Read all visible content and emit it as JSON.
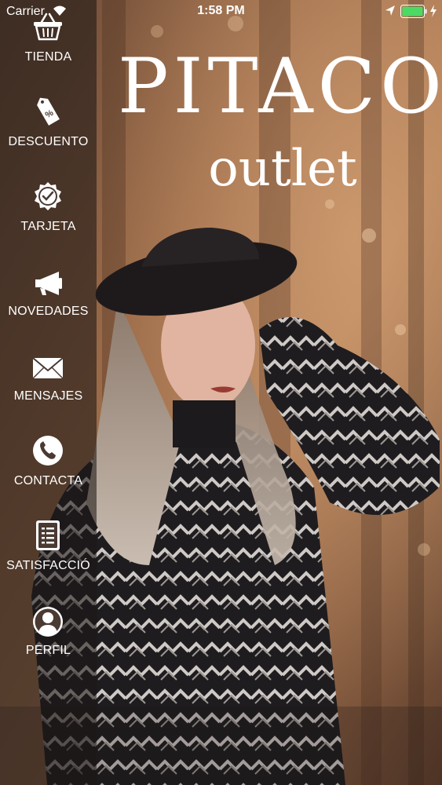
{
  "status_bar": {
    "carrier": "Carrier",
    "time": "1:58 PM",
    "battery_color": "#4cd964"
  },
  "logo": {
    "title": "PITACO",
    "subtitle": "outlet"
  },
  "menu": {
    "items": [
      {
        "label": "TIENDA",
        "icon": "shopping-basket-icon"
      },
      {
        "label": "DESCUENTO",
        "icon": "discount-tag-icon"
      },
      {
        "label": "TARJETA",
        "icon": "badge-check-icon"
      },
      {
        "label": "NOVEDADES",
        "icon": "megaphone-icon"
      },
      {
        "label": "MENSAJES",
        "icon": "envelope-icon"
      },
      {
        "label": "CONTACTA",
        "icon": "phone-icon"
      },
      {
        "label": "SATISFACCIÓ",
        "icon": "document-icon"
      },
      {
        "label": "PERFIL",
        "icon": "user-icon"
      }
    ]
  }
}
